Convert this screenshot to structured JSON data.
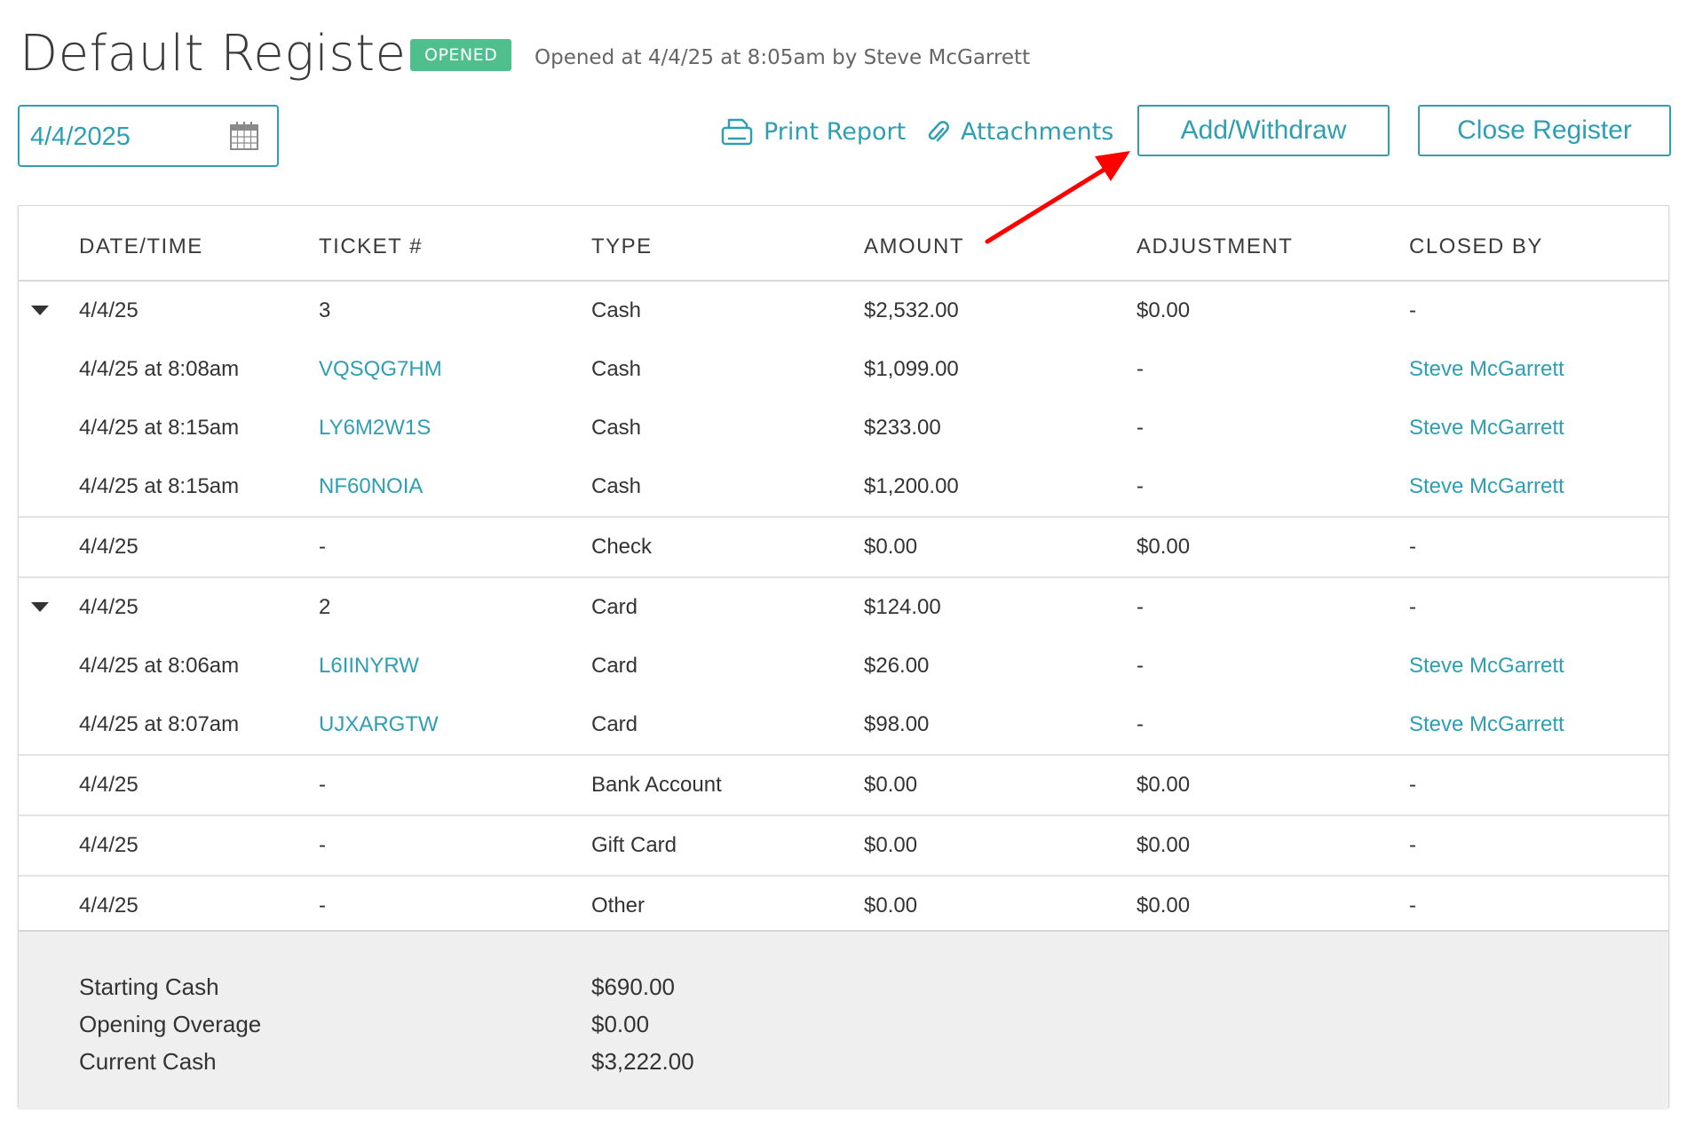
{
  "header": {
    "title": "Default Register",
    "status_badge": "OPENED",
    "opened_info": "Opened at 4/4/25 at 8:05am by Steve McGarrett"
  },
  "toolbar": {
    "date_value": "4/4/2025",
    "print_label": "Print Report",
    "attachments_label": "Attachments",
    "add_withdraw_label": "Add/Withdraw",
    "close_register_label": "Close Register"
  },
  "table": {
    "headers": [
      "DATE/TIME",
      "TICKET #",
      "TYPE",
      "AMOUNT",
      "ADJUSTMENT",
      "CLOSED BY"
    ],
    "rows": [
      {
        "group": true,
        "expanded": true,
        "date": "4/4/25",
        "ticket": "3",
        "type": "Cash",
        "amount": "$2,532.00",
        "adjustment": "$0.00",
        "closed_by": "-"
      },
      {
        "group": false,
        "date": "4/4/25 at 8:08am",
        "ticket": "VQSQG7HM",
        "type": "Cash",
        "amount": "$1,099.00",
        "adjustment": "-",
        "closed_by": "Steve McGarrett"
      },
      {
        "group": false,
        "date": "4/4/25 at 8:15am",
        "ticket": "LY6M2W1S",
        "type": "Cash",
        "amount": "$233.00",
        "adjustment": "-",
        "closed_by": "Steve McGarrett"
      },
      {
        "group": false,
        "date": "4/4/25 at 8:15am",
        "ticket": "NF60NOIA",
        "type": "Cash",
        "amount": "$1,200.00",
        "adjustment": "-",
        "closed_by": "Steve McGarrett"
      },
      {
        "group": true,
        "expanded": false,
        "date": "4/4/25",
        "ticket": "-",
        "type": "Check",
        "amount": "$0.00",
        "adjustment": "$0.00",
        "closed_by": "-"
      },
      {
        "group": true,
        "expanded": true,
        "date": "4/4/25",
        "ticket": "2",
        "type": "Card",
        "amount": "$124.00",
        "adjustment": "-",
        "closed_by": "-"
      },
      {
        "group": false,
        "date": "4/4/25 at 8:06am",
        "ticket": "L6IINYRW",
        "type": "Card",
        "amount": "$26.00",
        "adjustment": "-",
        "closed_by": "Steve McGarrett"
      },
      {
        "group": false,
        "date": "4/4/25 at 8:07am",
        "ticket": "UJXARGTW",
        "type": "Card",
        "amount": "$98.00",
        "adjustment": "-",
        "closed_by": "Steve McGarrett"
      },
      {
        "group": true,
        "expanded": false,
        "date": "4/4/25",
        "ticket": "-",
        "type": "Bank Account",
        "amount": "$0.00",
        "adjustment": "$0.00",
        "closed_by": "-"
      },
      {
        "group": true,
        "expanded": false,
        "date": "4/4/25",
        "ticket": "-",
        "type": "Gift Card",
        "amount": "$0.00",
        "adjustment": "$0.00",
        "closed_by": "-"
      },
      {
        "group": true,
        "expanded": false,
        "date": "4/4/25",
        "ticket": "-",
        "type": "Other",
        "amount": "$0.00",
        "adjustment": "$0.00",
        "closed_by": "-"
      }
    ]
  },
  "summary": [
    {
      "label": "Starting Cash",
      "value": "$690.00"
    },
    {
      "label": "Opening Overage",
      "value": "$0.00"
    },
    {
      "label": "Current Cash",
      "value": "$3,222.00"
    }
  ],
  "colors": {
    "accent": "#2e9fb3",
    "status_green": "#4fc08d",
    "annotation_red": "#ff0000"
  }
}
